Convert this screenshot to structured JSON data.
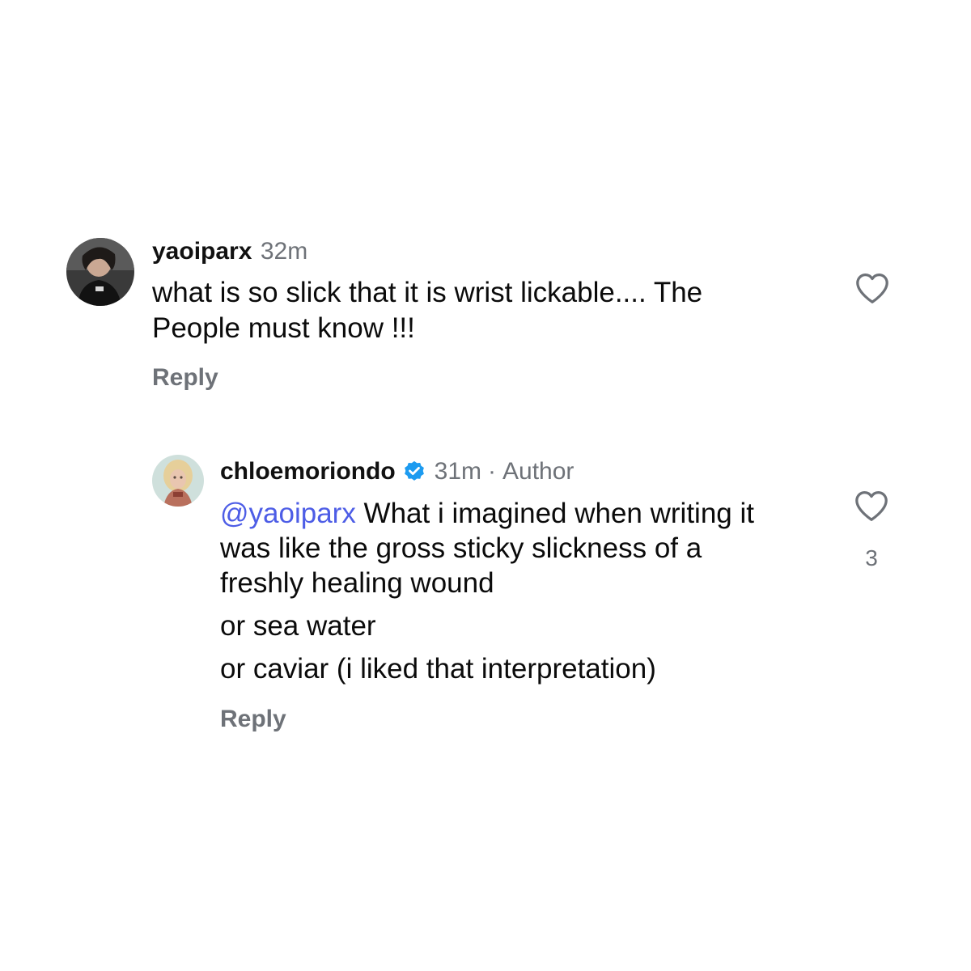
{
  "comment": {
    "username": "yaoiparx",
    "timestamp": "32m",
    "text_lines": [
      "what is so slick that it is wrist lickable.... The",
      "People must know !!!"
    ],
    "reply_label": "Reply"
  },
  "reply": {
    "username": "chloemoriondo",
    "verified_icon": "verified-badge-icon",
    "timestamp": "31m",
    "separator": "·",
    "author_tag": "Author",
    "mention": "@yaoiparx",
    "first_line_rest": " What i imagined when writing it",
    "text_lines": [
      "was like the gross sticky slickness of a",
      "freshly healing wound"
    ],
    "extra_lines": [
      "or sea water",
      "or caviar (i liked that interpretation)"
    ],
    "like_count": "3",
    "reply_label": "Reply"
  },
  "colors": {
    "background": "#ffffff",
    "secondary_text": "#6e7278",
    "mention": "#4d5de6",
    "verified": "#1d9bf0"
  }
}
